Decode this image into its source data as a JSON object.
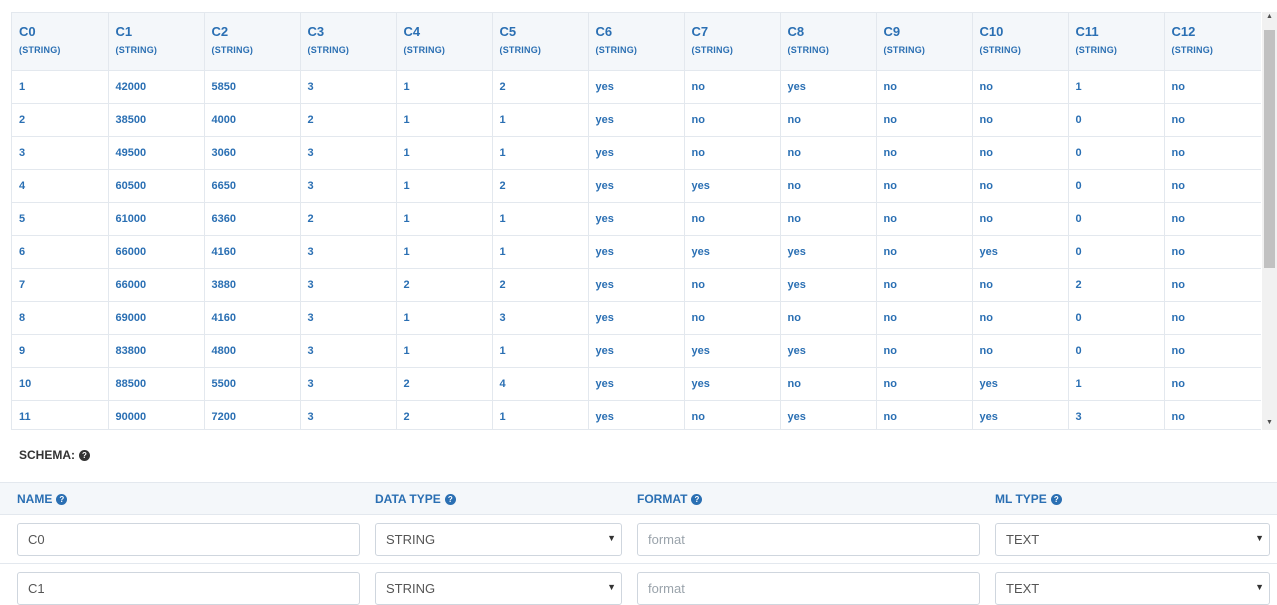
{
  "grid": {
    "columns": [
      {
        "name": "C0",
        "type": "(STRING)"
      },
      {
        "name": "C1",
        "type": "(STRING)"
      },
      {
        "name": "C2",
        "type": "(STRING)"
      },
      {
        "name": "C3",
        "type": "(STRING)"
      },
      {
        "name": "C4",
        "type": "(STRING)"
      },
      {
        "name": "C5",
        "type": "(STRING)"
      },
      {
        "name": "C6",
        "type": "(STRING)"
      },
      {
        "name": "C7",
        "type": "(STRING)"
      },
      {
        "name": "C8",
        "type": "(STRING)"
      },
      {
        "name": "C9",
        "type": "(STRING)"
      },
      {
        "name": "C10",
        "type": "(STRING)"
      },
      {
        "name": "C11",
        "type": "(STRING)"
      },
      {
        "name": "C12",
        "type": "(STRING)"
      }
    ],
    "rows": [
      [
        "1",
        "42000",
        "5850",
        "3",
        "1",
        "2",
        "yes",
        "no",
        "yes",
        "no",
        "no",
        "1",
        "no"
      ],
      [
        "2",
        "38500",
        "4000",
        "2",
        "1",
        "1",
        "yes",
        "no",
        "no",
        "no",
        "no",
        "0",
        "no"
      ],
      [
        "3",
        "49500",
        "3060",
        "3",
        "1",
        "1",
        "yes",
        "no",
        "no",
        "no",
        "no",
        "0",
        "no"
      ],
      [
        "4",
        "60500",
        "6650",
        "3",
        "1",
        "2",
        "yes",
        "yes",
        "no",
        "no",
        "no",
        "0",
        "no"
      ],
      [
        "5",
        "61000",
        "6360",
        "2",
        "1",
        "1",
        "yes",
        "no",
        "no",
        "no",
        "no",
        "0",
        "no"
      ],
      [
        "6",
        "66000",
        "4160",
        "3",
        "1",
        "1",
        "yes",
        "yes",
        "yes",
        "no",
        "yes",
        "0",
        "no"
      ],
      [
        "7",
        "66000",
        "3880",
        "3",
        "2",
        "2",
        "yes",
        "no",
        "yes",
        "no",
        "no",
        "2",
        "no"
      ],
      [
        "8",
        "69000",
        "4160",
        "3",
        "1",
        "3",
        "yes",
        "no",
        "no",
        "no",
        "no",
        "0",
        "no"
      ],
      [
        "9",
        "83800",
        "4800",
        "3",
        "1",
        "1",
        "yes",
        "yes",
        "yes",
        "no",
        "no",
        "0",
        "no"
      ],
      [
        "10",
        "88500",
        "5500",
        "3",
        "2",
        "4",
        "yes",
        "yes",
        "no",
        "no",
        "yes",
        "1",
        "no"
      ],
      [
        "11",
        "90000",
        "7200",
        "3",
        "2",
        "1",
        "yes",
        "no",
        "yes",
        "no",
        "yes",
        "3",
        "no"
      ]
    ]
  },
  "scrollbar": {
    "up_arrow": "▲",
    "down_arrow": "▼"
  },
  "schema": {
    "title": "SCHEMA:",
    "help_glyph": "?",
    "headers": {
      "name": "NAME",
      "data_type": "DATA TYPE",
      "format": "FORMAT",
      "ml_type": "ML TYPE"
    },
    "rows": [
      {
        "name": "C0",
        "data_type": "STRING",
        "format_placeholder": "format",
        "ml_type": "TEXT"
      },
      {
        "name": "C1",
        "data_type": "STRING",
        "format_placeholder": "format",
        "ml_type": "TEXT"
      }
    ],
    "caret_glyph": "▼"
  }
}
